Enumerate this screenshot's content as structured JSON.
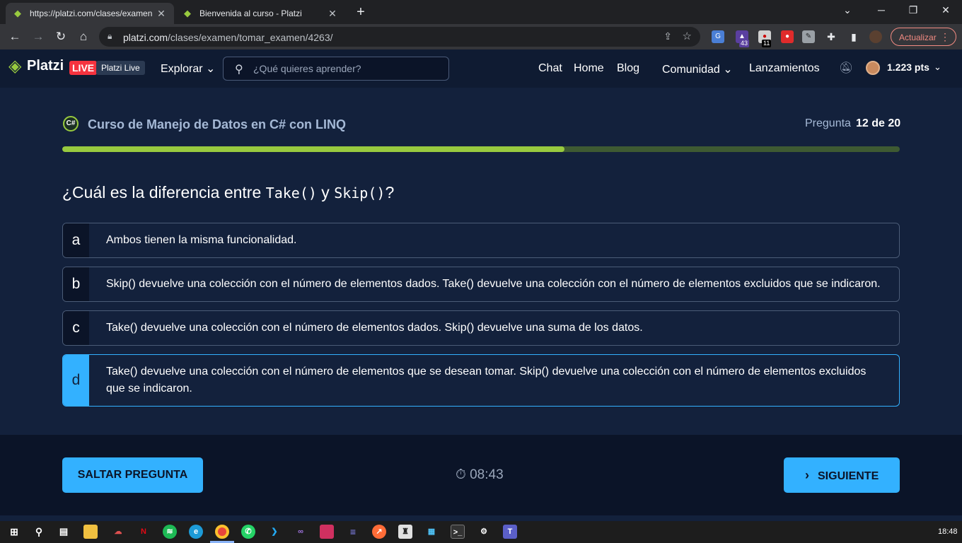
{
  "browser": {
    "tabs": [
      {
        "title": "https://platzi.com/clases/examen",
        "active": true
      },
      {
        "title": "Bienvenida al curso - Platzi",
        "active": false
      }
    ],
    "url_domain": "platzi.com",
    "url_path": "/clases/examen/tomar_examen/4263/",
    "update_label": "Actualizar",
    "ext_badges": [
      "43",
      "11"
    ]
  },
  "header": {
    "logo": "Platzi",
    "live_badge": "LIVE",
    "live_name": "Platzi Live",
    "explore": "Explorar",
    "search_placeholder": "¿Qué quieres aprender?",
    "nav": [
      "Chat",
      "Home",
      "Blog",
      "Comunidad",
      "Lanzamientos"
    ],
    "points": "1.223 pts"
  },
  "exam": {
    "course_title": "Curso de Manejo de Datos en C# con LINQ",
    "question_label": "Pregunta",
    "question_count": "12 de 20",
    "progress_fraction": 0.6,
    "question": {
      "pre": "¿Cuál es la diferencia entre ",
      "code1": "Take()",
      "mid": " y ",
      "code2": "Skip()",
      "post": "?"
    },
    "options": [
      {
        "letter": "a",
        "text": "Ambos tienen la misma funcionalidad.",
        "selected": false
      },
      {
        "letter": "b",
        "text": "Skip() devuelve una colección con el número de elementos dados. Take() devuelve una colección con el número de elementos excluidos que se indicaron.",
        "selected": false
      },
      {
        "letter": "c",
        "text": "Take() devuelve una colección con el número de elementos dados. Skip() devuelve una suma de los datos.",
        "selected": false
      },
      {
        "letter": "d",
        "text": "Take() devuelve una colección con el número de elementos que se desean tomar. Skip() devuelve una colección con el número de elementos excluidos que se indicaron.",
        "selected": true
      }
    ],
    "skip_label": "SALTAR PREGUNTA",
    "timer": "08:43",
    "next_label": "SIGUIENTE"
  },
  "taskbar": {
    "clock": "18:48"
  },
  "colors": {
    "accent": "#33b1ff",
    "brand": "#98ca3f",
    "background": "#13213c",
    "live": "#f5333f"
  }
}
